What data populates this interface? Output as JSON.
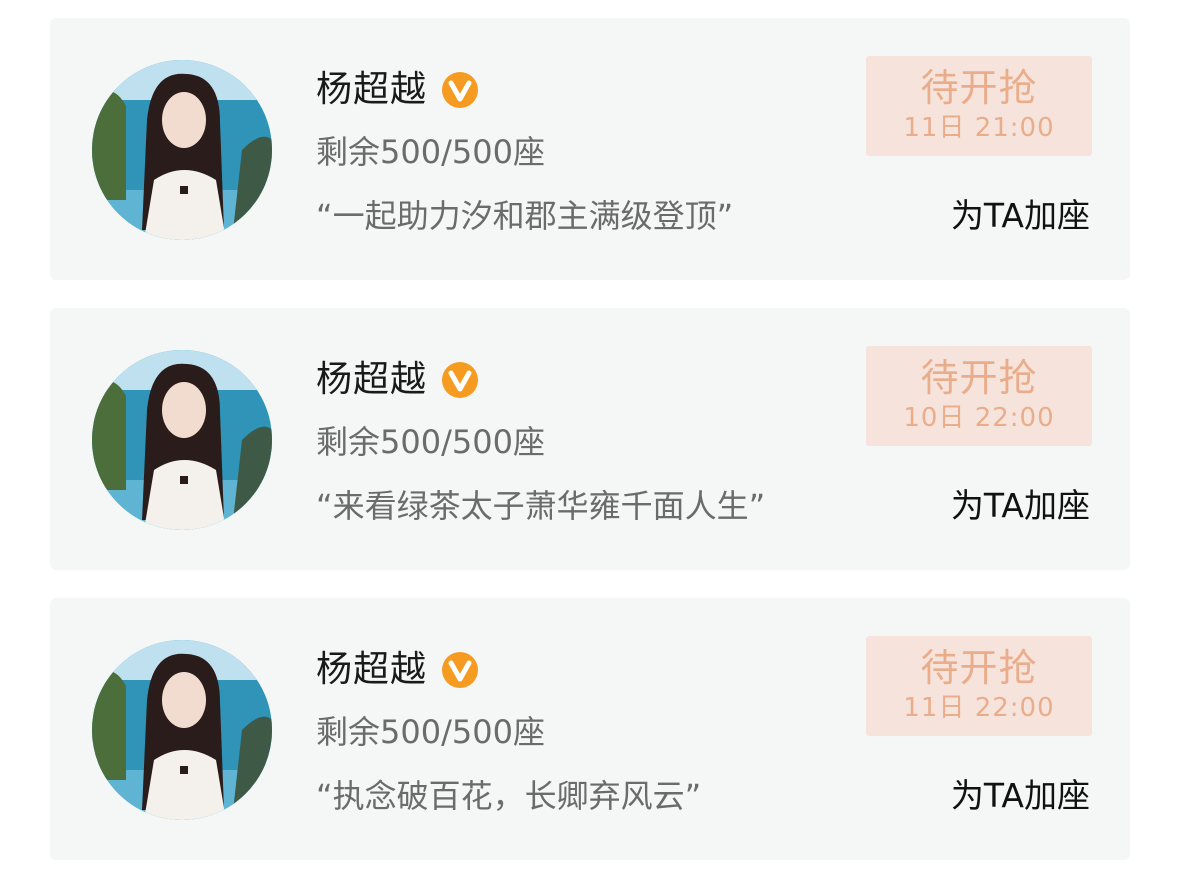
{
  "colors": {
    "card_bg": "#f5f6f6",
    "badge_orange": "#f59b22",
    "grab_bg": "#f6e4dc",
    "grab_text": "#e9ad8b",
    "name_text": "#1a1a1a",
    "secondary_text": "#6b6b6b"
  },
  "cards": [
    {
      "name": "杨超越",
      "verified_icon": "orange-v-verified-icon",
      "seats": "剩余500/500座",
      "quote": "“一起助力汐和郡主满级登顶”",
      "status": "待开抢",
      "time": "11日 21:00",
      "action": "为TA加座"
    },
    {
      "name": "杨超越",
      "verified_icon": "orange-v-verified-icon",
      "seats": "剩余500/500座",
      "quote": "“来看绿茶太子萧华雍千面人生”",
      "status": "待开抢",
      "time": "10日 22:00",
      "action": "为TA加座"
    },
    {
      "name": "杨超越",
      "verified_icon": "orange-v-verified-icon",
      "seats": "剩余500/500座",
      "quote": "“执念破百花，长卿弃风云”",
      "status": "待开抢",
      "time": "11日 22:00",
      "action": "为TA加座"
    }
  ]
}
